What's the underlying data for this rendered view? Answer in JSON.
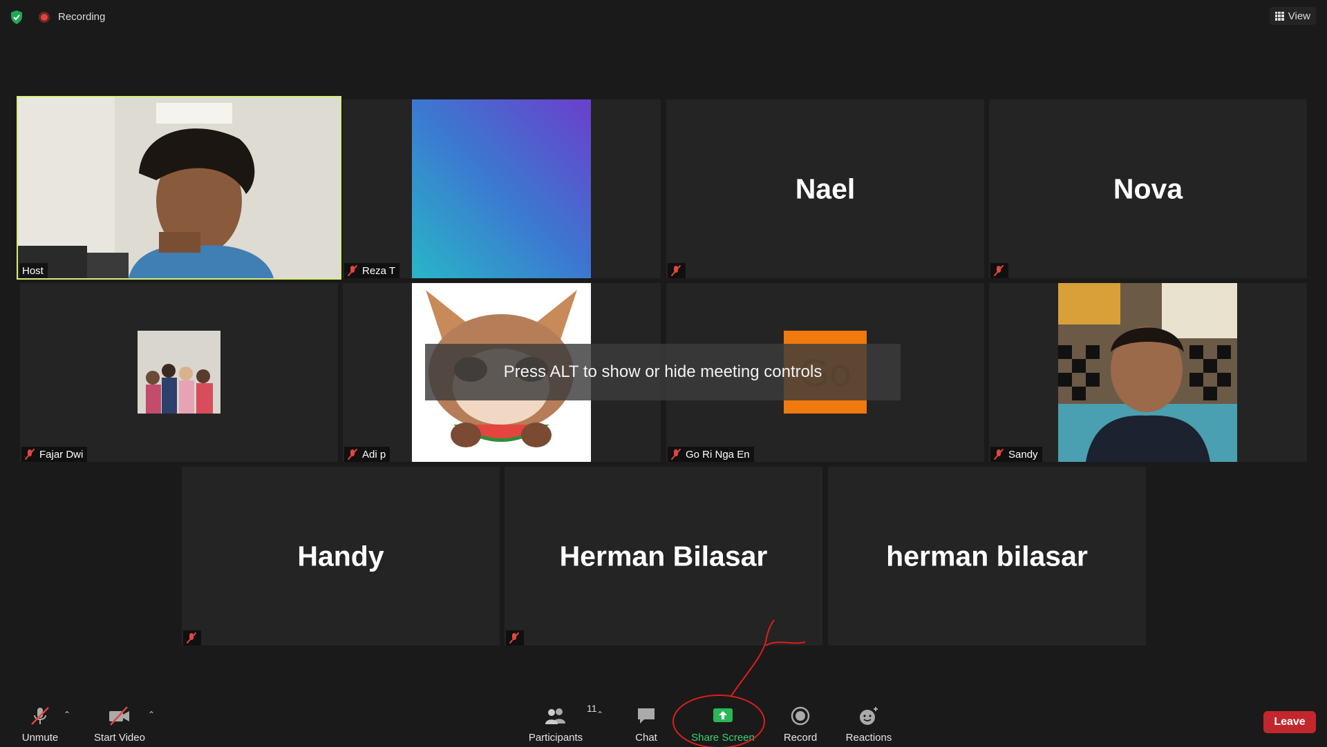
{
  "topbar": {
    "recording_label": "Recording",
    "view_label": "View"
  },
  "tiles": {
    "host": {
      "label": "Host"
    },
    "reza": {
      "label": "Reza T"
    },
    "nael": {
      "name": "Nael"
    },
    "nova": {
      "name": "Nova"
    },
    "fajar": {
      "label": "Fajar Dwi"
    },
    "adi": {
      "label": "Adi p"
    },
    "gori": {
      "label": "Go Ri Nga En",
      "avatar_text": "Go"
    },
    "sandy": {
      "label": "Sandy"
    },
    "handy": {
      "name": "Handy"
    },
    "herman1": {
      "name": "Herman Bilasar"
    },
    "herman2": {
      "name": "herman bilasar"
    }
  },
  "overlay": {
    "tip": "Press ALT to show or hide meeting controls"
  },
  "toolbar": {
    "unmute": "Unmute",
    "start_video": "Start Video",
    "participants": "Participants",
    "participants_count": "11",
    "chat": "Chat",
    "share_screen": "Share Screen",
    "record": "Record",
    "reactions": "Reactions",
    "leave": "Leave"
  },
  "colors": {
    "background": "#1a1a1a",
    "tile": "#242424",
    "host_border": "#d6ee7a",
    "share_green": "#39d46b",
    "leave_red": "#c2272d",
    "muted_red": "#e2463d",
    "avatar_orange": "#f07a0e"
  }
}
